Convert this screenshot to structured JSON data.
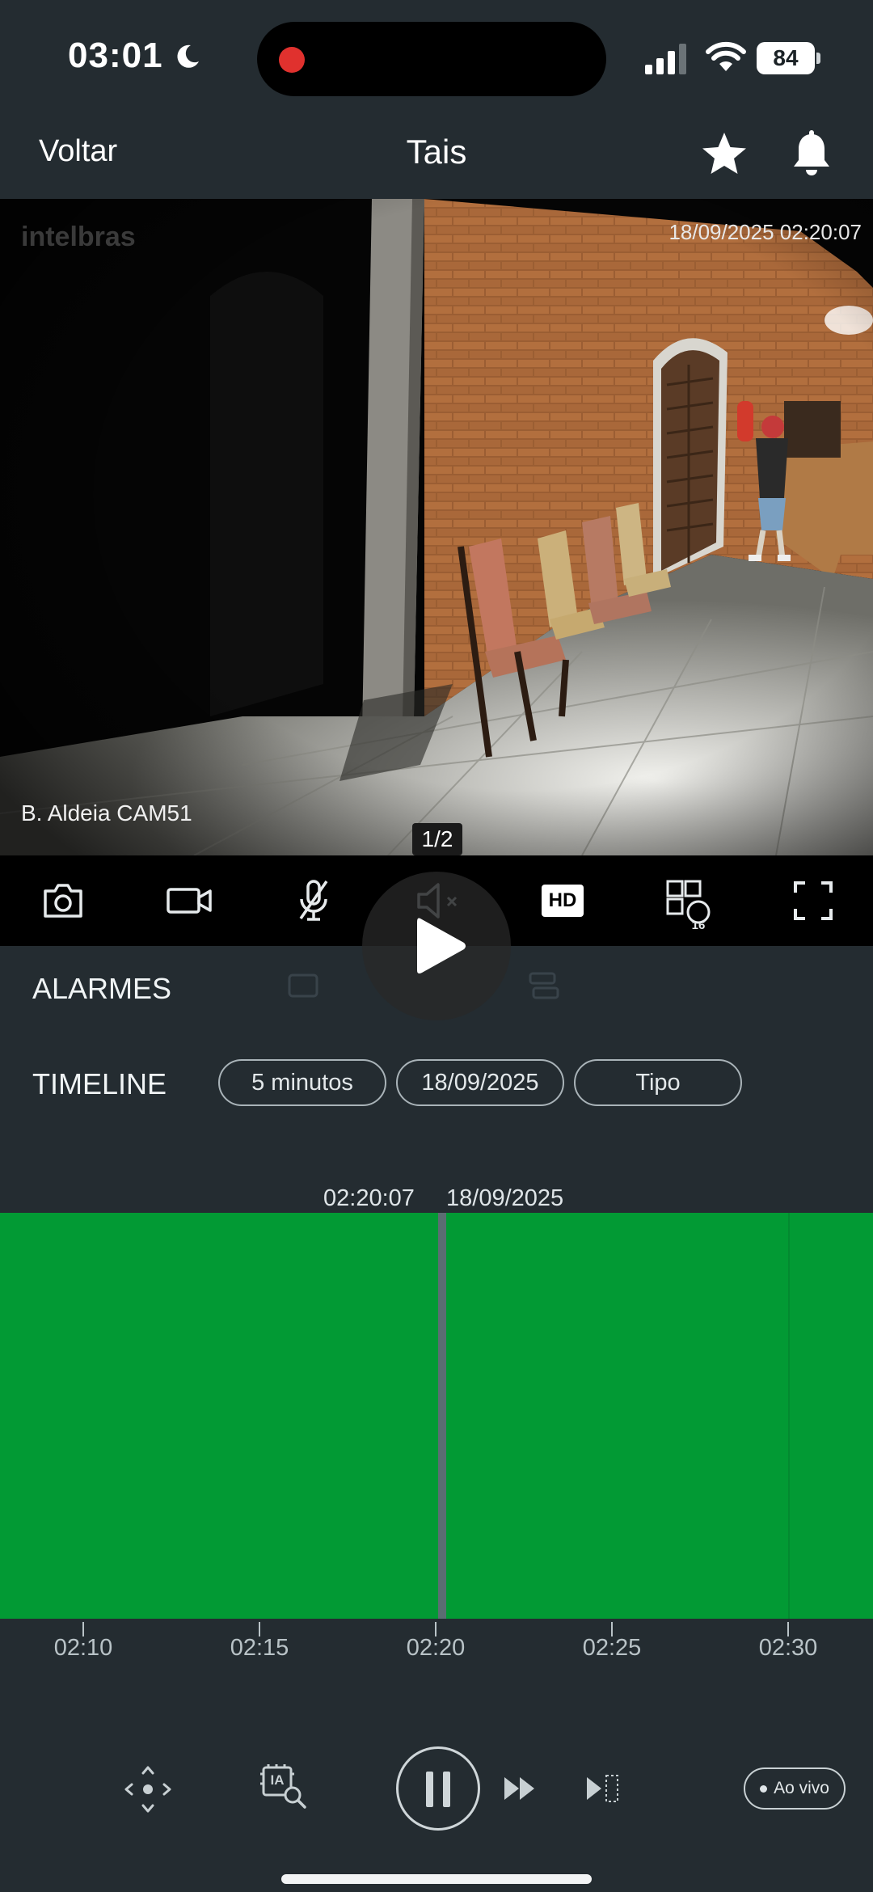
{
  "status_bar": {
    "time": "03:01",
    "battery": "84",
    "icons": [
      "moon-icon",
      "record-dot",
      "signal-icon",
      "wifi-icon",
      "battery-icon"
    ]
  },
  "nav": {
    "back_label": "Voltar",
    "title": "Tais",
    "icons": [
      "star-icon",
      "bell-icon"
    ]
  },
  "video": {
    "brand": "intelbras",
    "timestamp": "18/09/2025 02:20:07",
    "camera_name": "B. Aldeia CAM51",
    "page_indicator": "1/2"
  },
  "toolbar": {
    "icons": [
      "camera-snapshot-icon",
      "video-record-icon",
      "mic-muted-icon",
      "speaker-muted-icon",
      "hd-quality-icon",
      "grid-16-icon",
      "fullscreen-icon"
    ],
    "hd_label": "HD",
    "grid_badge": "16"
  },
  "sections": {
    "alarms_label": "ALARMES",
    "timeline_label": "TIMELINE"
  },
  "chips": {
    "interval": "5 minutos",
    "date": "18/09/2025",
    "type": "Tipo"
  },
  "timeline": {
    "cursor_time": "02:20:07",
    "cursor_date": "18/09/2025",
    "recording_color": "#029a34",
    "ticks": [
      "02:10",
      "02:15",
      "02:20",
      "02:25",
      "02:30"
    ]
  },
  "controls": {
    "icons": [
      "ptz-move-icon",
      "ai-search-icon",
      "pause-icon",
      "fast-forward-icon",
      "next-frame-icon"
    ],
    "live_label": "Ao vivo",
    "ai_label": "IA"
  }
}
